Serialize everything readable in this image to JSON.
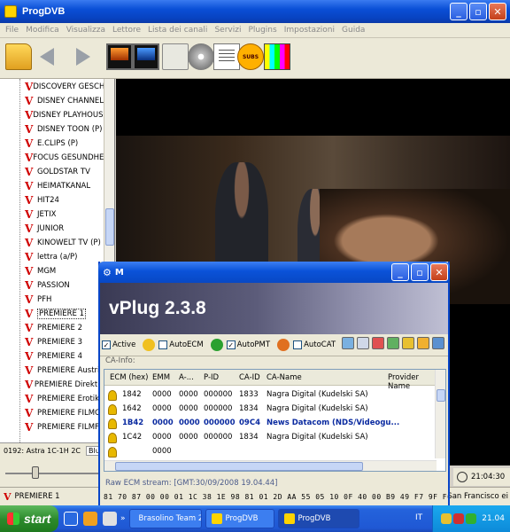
{
  "window": {
    "title": "ProgDVB"
  },
  "menu": [
    "File",
    "Modifica",
    "Visualizza",
    "Lettore",
    "Lista dei canali",
    "Servizi",
    "Plugins",
    "Impostazioni",
    "Guida"
  ],
  "toolbar": {
    "subs_label": "SUBS"
  },
  "channels": [
    "DISCOVERY GESCHI",
    "DISNEY CHANNEL",
    "DISNEY PLAYHOUSE",
    "DISNEY TOON (P)",
    "E.CLIPS (P)",
    "FOCUS GESUNDHEI",
    "GOLDSTAR TV",
    "HEIMATKANAL",
    "HIT24",
    "JETIX",
    "JUNIOR",
    "KINOWELT TV (P)",
    "lettra (a/P)",
    "MGM",
    "PASSION",
    "PFH",
    "PREMIERE 1",
    "PREMIERE 2",
    "PREMIERE 3",
    "PREMIERE 4",
    "PREMIERE Austria",
    "PREMIERE Direkt P",
    "PREMIERE Erotik I",
    "PREMIERE FILMCL",
    "PREMIERE FILMFE"
  ],
  "selected_channel": "PREMIERE 1",
  "infostrip": {
    "transponder": "0192: Astra 1C-1H  2C",
    "tab": "Blu"
  },
  "status": {
    "channel": "PREMIERE 1",
    "ticker": "in San Francisco ei",
    "clock": "21:04:30"
  },
  "dialog": {
    "title": "M",
    "banner": "vPlug 2.3.8",
    "options": {
      "active": "Active",
      "autoecm": "AutoECM",
      "autopmt": "AutoPMT",
      "autocat": "AutoCAT"
    },
    "ca_info_label": "CA-Info:",
    "columns": [
      "ECM (hex)",
      "EMM",
      "A-...",
      "P-ID",
      "CA-ID",
      "CA-Name",
      "Provider Name"
    ],
    "rows": [
      [
        "1842",
        "0000",
        "0000",
        "000000",
        "1833",
        "Nagra Digital (Kudelski SA)"
      ],
      [
        "1642",
        "0000",
        "0000",
        "000000",
        "1834",
        "Nagra Digital (Kudelski SA)"
      ],
      [
        "1B42",
        "0000",
        "0000",
        "000000",
        "09C4",
        "News Datacom (NDS/Videogu..."
      ],
      [
        "1C42",
        "0000",
        "0000",
        "000000",
        "1834",
        "Nagra Digital (Kudelski SA)"
      ],
      [
        "",
        "0000",
        "",
        "",
        "",
        ""
      ]
    ],
    "highlighted_row": 2,
    "raw_label": "Raw ECM stream: [GMT:30/09/2008 19.04.44]",
    "raw_hex": "81 70 87 00 00 01 1C 38 1E 98 81 01 2D AA 55 05 10 0F 40 00 B9 49 F7 9F F6"
  },
  "taskbar": {
    "start": "start",
    "tasks": [
      "Brasolino Team 20...",
      "ProgDVB",
      "ProgDVB"
    ],
    "lang": "IT",
    "clock": "21.04"
  },
  "colors": {
    "xp_blue": "#0a4fd6",
    "start_green": "#2e8b2e",
    "channel_mark_red": "#d00000"
  }
}
